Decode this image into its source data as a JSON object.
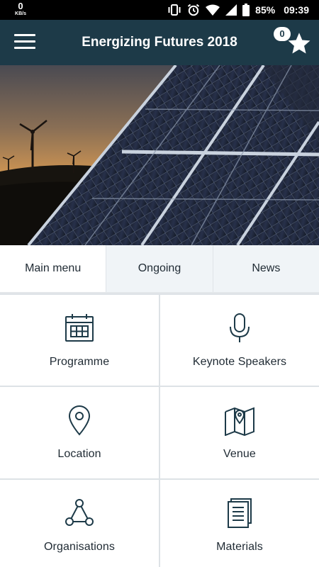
{
  "status_bar": {
    "data_speed": "0",
    "data_unit": "KB/s",
    "battery": "85%",
    "time": "09:39"
  },
  "app_bar": {
    "title": "Energizing Futures 2018",
    "favorites_count": "0",
    "icons": [
      "hamburger-menu-icon",
      "star-icon"
    ]
  },
  "hero": {
    "description_icon": "solar-panels-wind-turbines-image"
  },
  "tabs": [
    {
      "label": "Main menu",
      "active": true
    },
    {
      "label": "Ongoing",
      "active": false
    },
    {
      "label": "News",
      "active": false
    }
  ],
  "menu": [
    {
      "label": "Programme",
      "icon": "calendar-icon"
    },
    {
      "label": "Keynote Speakers",
      "icon": "microphone-icon"
    },
    {
      "label": "Location",
      "icon": "map-pin-icon"
    },
    {
      "label": "Venue",
      "icon": "folded-map-icon"
    },
    {
      "label": "Organisations",
      "icon": "network-icon"
    },
    {
      "label": "Materials",
      "icon": "documents-icon"
    }
  ],
  "colors": {
    "app_bar": "#1d3a48",
    "icon_stroke": "#1d3a48",
    "tab_inactive_bg": "#f0f4f7",
    "grid_divider": "#dde2e6"
  }
}
